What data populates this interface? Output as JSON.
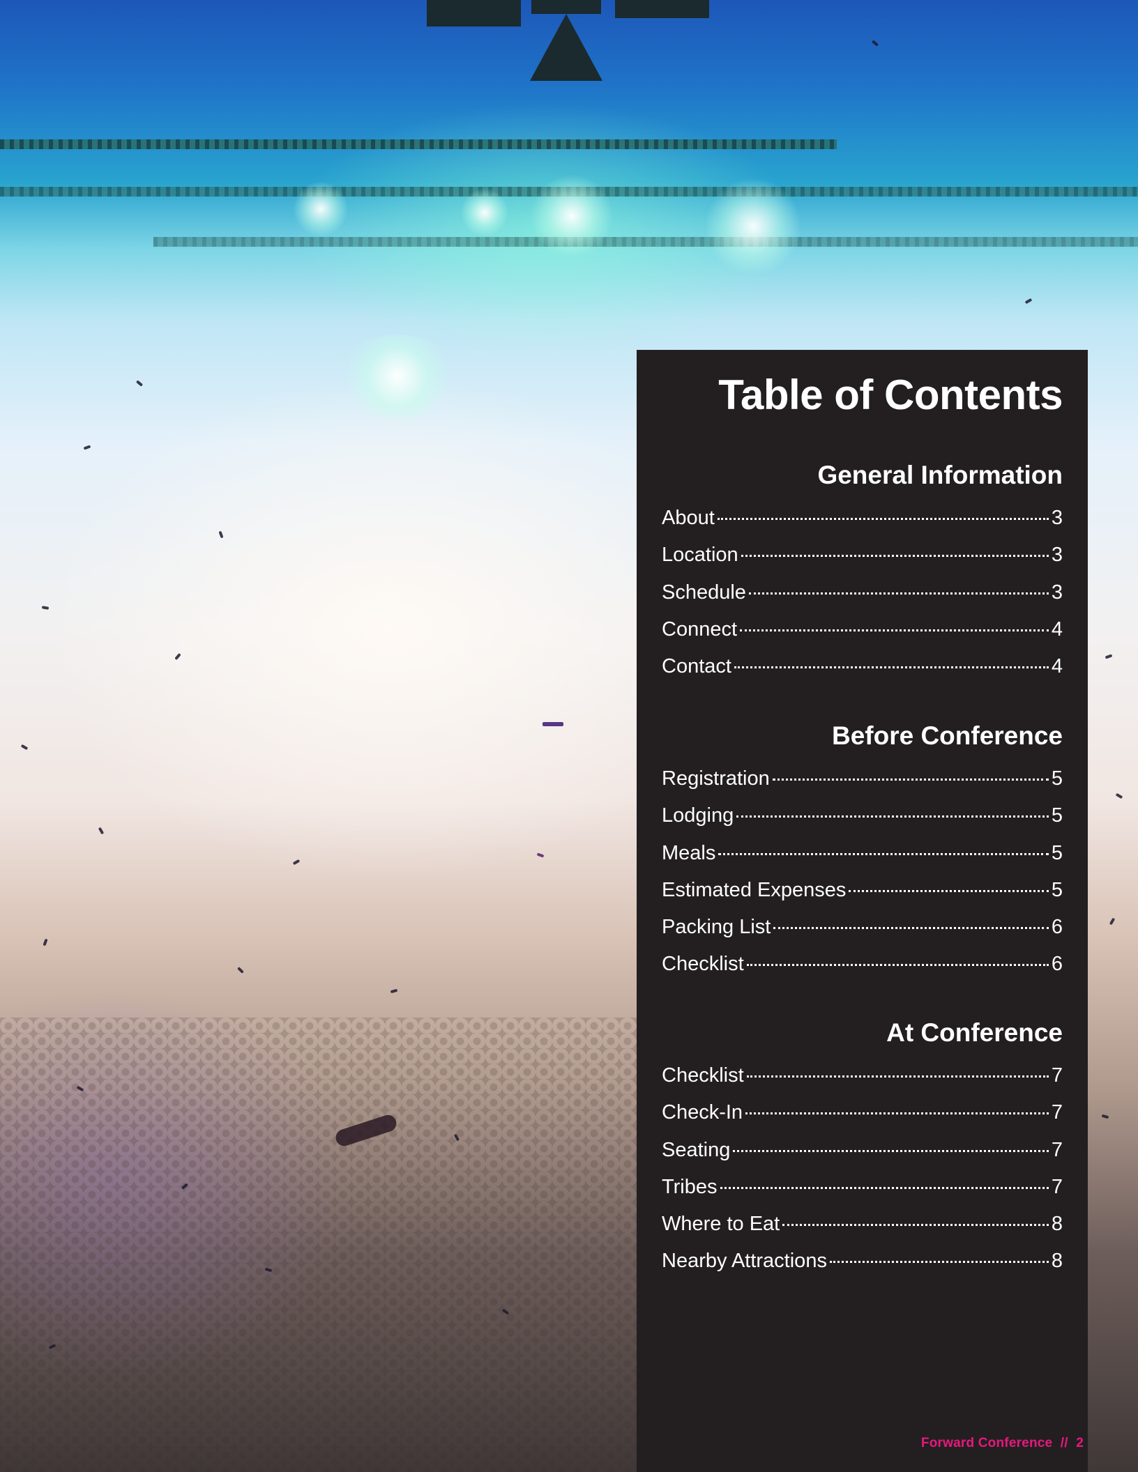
{
  "toc": {
    "title": "Table of Contents",
    "sections": [
      {
        "heading": "General Information",
        "entries": [
          {
            "label": "About",
            "page": "3"
          },
          {
            "label": "Location",
            "page": "3"
          },
          {
            "label": "Schedule",
            "page": "3"
          },
          {
            "label": "Connect",
            "page": "4"
          },
          {
            "label": "Contact",
            "page": "4"
          }
        ]
      },
      {
        "heading": "Before Conference",
        "entries": [
          {
            "label": "Registration",
            "page": "5"
          },
          {
            "label": "Lodging",
            "page": "5"
          },
          {
            "label": "Meals",
            "page": "5"
          },
          {
            "label": "Estimated Expenses",
            "page": "5"
          },
          {
            "label": "Packing List",
            "page": "6"
          },
          {
            "label": "Checklist",
            "page": "6"
          }
        ]
      },
      {
        "heading": "At Conference",
        "entries": [
          {
            "label": "Checklist",
            "page": "7"
          },
          {
            "label": "Check-In",
            "page": "7"
          },
          {
            "label": "Seating",
            "page": "7"
          },
          {
            "label": "Tribes",
            "page": "7"
          },
          {
            "label": "Where to Eat",
            "page": "8"
          },
          {
            "label": "Nearby Attractions",
            "page": "8"
          }
        ]
      }
    ]
  },
  "footer": {
    "publication": "Forward Conference",
    "separator": "//",
    "page_number": "2"
  },
  "colors": {
    "panel_background": "#231f20",
    "text": "#ffffff",
    "accent": "#e5197e"
  }
}
